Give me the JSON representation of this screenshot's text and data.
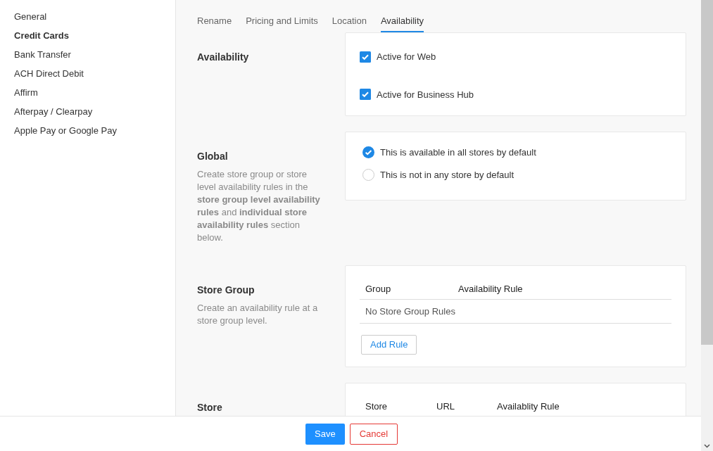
{
  "sidebar": {
    "items": [
      {
        "label": "General",
        "selected": false
      },
      {
        "label": "Credit Cards",
        "selected": true
      },
      {
        "label": "Bank Transfer",
        "selected": false
      },
      {
        "label": "ACH Direct Debit",
        "selected": false
      },
      {
        "label": "Affirm",
        "selected": false
      },
      {
        "label": "Afterpay / Clearpay",
        "selected": false
      },
      {
        "label": "Apple Pay or Google Pay",
        "selected": false
      }
    ]
  },
  "tabs": [
    {
      "label": "Rename",
      "selected": false
    },
    {
      "label": "Pricing and Limits",
      "selected": false
    },
    {
      "label": "Location",
      "selected": false
    },
    {
      "label": "Availability",
      "selected": true
    }
  ],
  "sections": [
    {
      "kind": "checkboxes",
      "title": "Availability",
      "options": [
        {
          "label": "Active for Web",
          "checked": true
        },
        {
          "label": "Active for Business Hub",
          "checked": true
        }
      ]
    },
    {
      "kind": "radios",
      "title": "Global",
      "description": "Create store group or store level availability rules in the **store group level availability rules** and **individual store availability rules** section below.",
      "options": [
        {
          "label": "This is available in all stores by default",
          "selected": true
        },
        {
          "label": "This is not in any store by default",
          "selected": false
        }
      ]
    },
    {
      "kind": "table",
      "title": "Store Group",
      "description": "Create an availability rule at a store group level.",
      "columns": [
        "Group",
        "Availability Rule"
      ],
      "empty_text": "No Store Group Rules",
      "button": "Add Rule"
    },
    {
      "kind": "table",
      "title": "Store",
      "columns": [
        "Store",
        "URL",
        "Availablity Rule"
      ]
    }
  ],
  "footer": {
    "buttons": [
      {
        "label": "Save",
        "kind": "primary"
      },
      {
        "label": "Cancel",
        "kind": "secondary"
      }
    ]
  }
}
